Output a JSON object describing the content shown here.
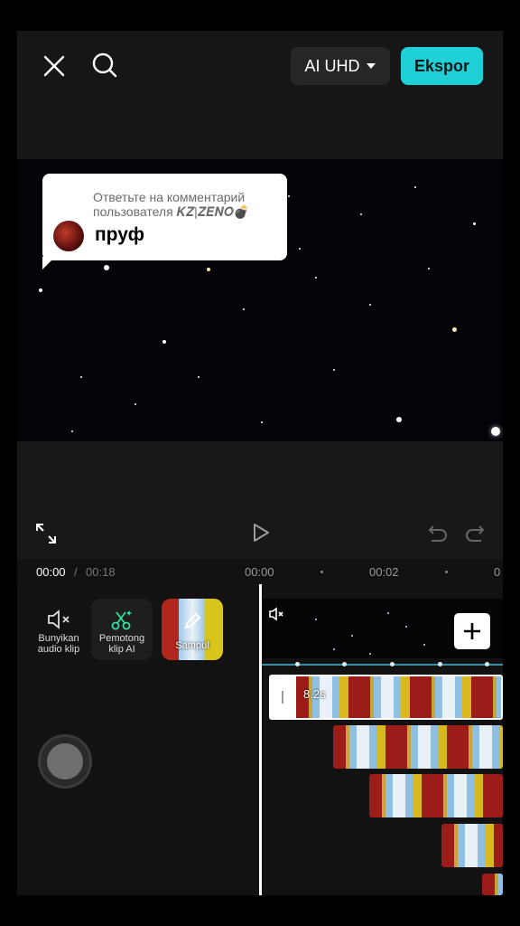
{
  "topbar": {
    "close_icon": "close-icon",
    "search_icon": "search-icon",
    "resolution_label": "AI UHD",
    "export_label": "Ekspor"
  },
  "preview": {
    "comment_reply": "Ответьте на комментарий пользователя 𝑲𝒁|𝒁𝑬𝑵𝑶💣",
    "comment_body": "пруф"
  },
  "timeline": {
    "current_time": "00:00",
    "separator": "/",
    "total_time": "00:18",
    "ticks": [
      "00:00",
      "00:02",
      "0"
    ]
  },
  "tools": {
    "mute_label": "Bunyikan audio klip",
    "ai_cut_label": "Pemotong klip AI",
    "cover_label": "Sampul"
  },
  "clip": {
    "duration": "8.2s"
  },
  "colors": {
    "accent": "#1fd0d6",
    "background": "#141414"
  }
}
